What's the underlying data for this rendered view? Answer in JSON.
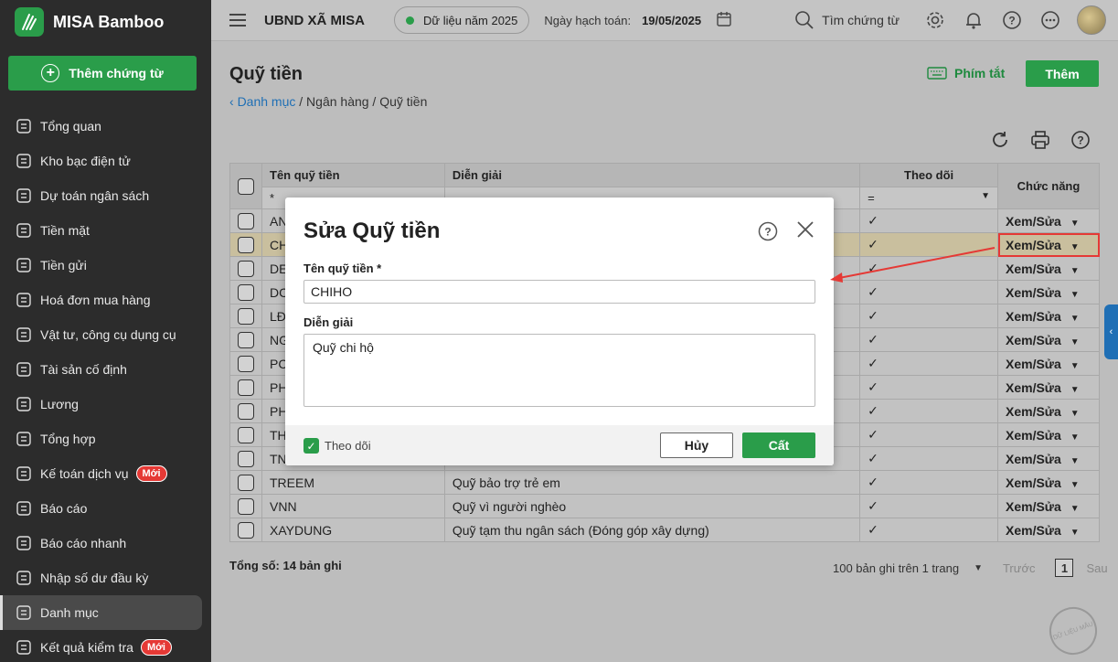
{
  "app": {
    "name": "MISA Bamboo",
    "add_voucher_label": "Thêm chứng từ"
  },
  "sidebar": {
    "items": [
      {
        "label": "Tổng quan",
        "icon": "pie-chart-icon"
      },
      {
        "label": "Kho bạc điện tử",
        "icon": "monitor-icon"
      },
      {
        "label": "Dự toán ngân sách",
        "icon": "budget-icon"
      },
      {
        "label": "Tiền mặt",
        "icon": "cash-icon"
      },
      {
        "label": "Tiền gửi",
        "icon": "deposit-icon"
      },
      {
        "label": "Hoá đơn mua hàng",
        "icon": "invoice-icon"
      },
      {
        "label": "Vật tư, công cụ dụng cụ",
        "icon": "tools-icon"
      },
      {
        "label": "Tài sản cố định",
        "icon": "building-icon"
      },
      {
        "label": "Lương",
        "icon": "salary-icon"
      },
      {
        "label": "Tổng hợp",
        "icon": "summary-icon"
      },
      {
        "label": "Kế toán dịch vụ",
        "icon": "service-icon",
        "badge": "Mới"
      },
      {
        "label": "Báo cáo",
        "icon": "report-icon"
      },
      {
        "label": "Báo cáo nhanh",
        "icon": "quick-report-icon"
      },
      {
        "label": "Nhập số dư đầu kỳ",
        "icon": "opening-balance-icon"
      },
      {
        "label": "Danh mục",
        "icon": "catalog-icon",
        "active": true
      },
      {
        "label": "Kết quả kiểm tra",
        "icon": "check-result-icon",
        "badge": "Mới"
      }
    ]
  },
  "topbar": {
    "org": "UBND XÃ MISA",
    "data_year": "Dữ liệu năm 2025",
    "posting_label": "Ngày hạch toán:",
    "posting_date": "19/05/2025",
    "search_label": "Tìm chứng từ"
  },
  "page": {
    "title": "Quỹ tiền",
    "breadcrumb_link": "Danh mục",
    "breadcrumb_rest": " / Ngân hàng / Quỹ tiền",
    "shortcut_label": "Phím tắt",
    "add_label": "Thêm"
  },
  "table": {
    "headers": {
      "name": "Tên quỹ tiền",
      "desc": "Diễn giải",
      "follow": "Theo dõi",
      "fn": "Chức năng"
    },
    "filter_name": "*",
    "filter_follow": "=",
    "rows": [
      {
        "name": "AN",
        "desc": "",
        "check": "✓",
        "action": "Xem/Sửa"
      },
      {
        "name": "CH",
        "desc": "",
        "check": "✓",
        "action": "Xem/Sửa",
        "highlight": true
      },
      {
        "name": "DE",
        "desc": "",
        "check": "✓",
        "action": "Xem/Sửa"
      },
      {
        "name": "DC",
        "desc": "",
        "check": "✓",
        "action": "Xem/Sửa"
      },
      {
        "name": "LĐ",
        "desc": "",
        "check": "✓",
        "action": "Xem/Sửa"
      },
      {
        "name": "NG",
        "desc": "",
        "check": "✓",
        "action": "Xem/Sửa"
      },
      {
        "name": "PC",
        "desc": "",
        "check": "✓",
        "action": "Xem/Sửa"
      },
      {
        "name": "PH",
        "desc": "",
        "check": "✓",
        "action": "Xem/Sửa"
      },
      {
        "name": "PH",
        "desc": "",
        "check": "✓",
        "action": "Xem/Sửa"
      },
      {
        "name": "TH",
        "desc": "",
        "check": "✓",
        "action": "Xem/Sửa"
      },
      {
        "name": "TN",
        "desc": "",
        "check": "✓",
        "action": "Xem/Sửa"
      },
      {
        "name": "TREEM",
        "desc": "Quỹ bảo trợ trẻ em",
        "check": "✓",
        "action": "Xem/Sửa"
      },
      {
        "name": "VNN",
        "desc": "Quỹ vì người nghèo",
        "check": "✓",
        "action": "Xem/Sửa"
      },
      {
        "name": "XAYDUNG",
        "desc": "Quỹ tạm thu ngân sách (Đóng góp xây dựng)",
        "check": "✓",
        "action": "Xem/Sửa"
      }
    ],
    "total": "Tổng số: 14 bản ghi",
    "page_size": "100 bản ghi trên 1 trang",
    "prev": "Trước",
    "page": "1",
    "next": "Sau"
  },
  "modal": {
    "title": "Sửa Quỹ tiền",
    "name_label": "Tên quỹ tiền *",
    "name_value": "CHIHO",
    "desc_label": "Diễn giải",
    "desc_value": "Quỹ chi hộ",
    "follow_label": "Theo dõi",
    "cancel_label": "Hủy",
    "save_label": "Cất"
  },
  "colors": {
    "accent": "#2a9d4a",
    "link": "#1a5ea8",
    "highlight_box": "#e53935"
  }
}
